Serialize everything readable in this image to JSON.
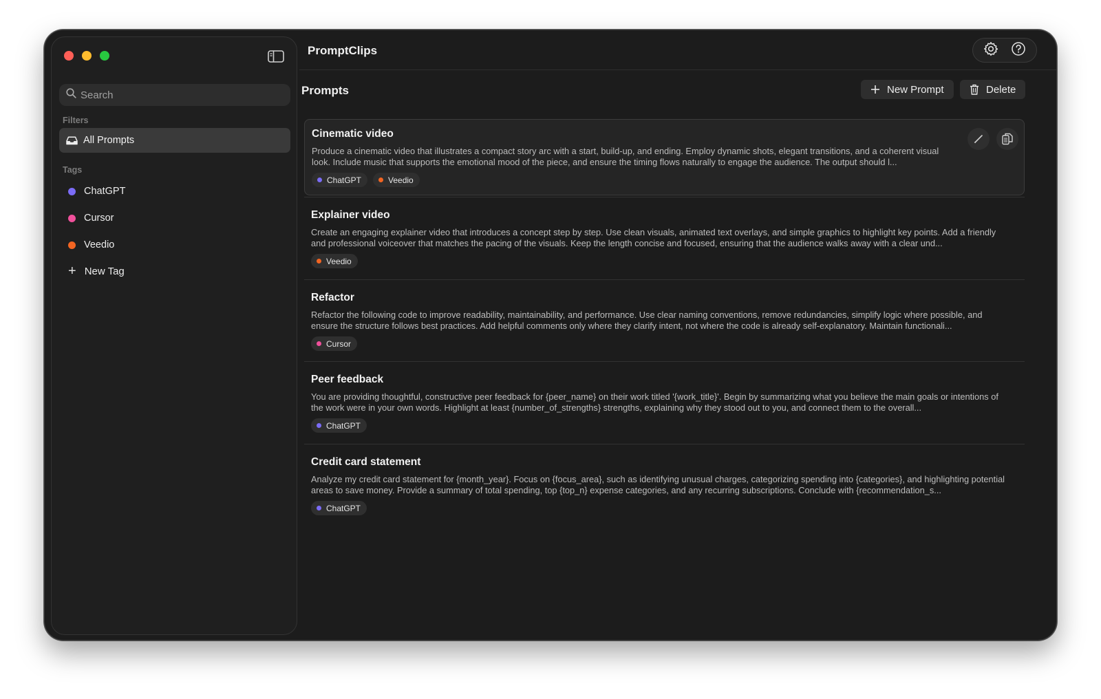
{
  "app": {
    "title": "PromptClips"
  },
  "colors": {
    "chatgpt": "#7b6cf6",
    "cursor": "#f0509b",
    "veedio": "#f26522"
  },
  "sidebar": {
    "search_placeholder": "Search",
    "filters_label": "Filters",
    "all_prompts_label": "All Prompts",
    "tags_label": "Tags",
    "tags": [
      {
        "label": "ChatGPT",
        "color": "#7b6cf6"
      },
      {
        "label": "Cursor",
        "color": "#f0509b"
      },
      {
        "label": "Veedio",
        "color": "#f26522"
      }
    ],
    "new_tag_label": "New Tag"
  },
  "main": {
    "heading": "Prompts",
    "new_prompt_label": "New Prompt",
    "delete_label": "Delete",
    "prompts": [
      {
        "title": "Cinematic video",
        "description": "Produce a cinematic video that illustrates a compact story arc with a start, build-up, and ending. Employ dynamic shots, elegant transitions, and a coherent visual look. Include music that supports the emotional mood of the piece, and ensure the timing flows naturally to engage the audience. The output should l...",
        "tags": [
          {
            "label": "ChatGPT",
            "color": "#7b6cf6"
          },
          {
            "label": "Veedio",
            "color": "#f26522"
          }
        ]
      },
      {
        "title": "Explainer video",
        "description": "Create an engaging explainer video that introduces a concept step by step. Use clean visuals, animated text overlays, and simple graphics to highlight key points. Add a friendly and professional voiceover that matches the pacing of the visuals. Keep the length concise and focused, ensuring that the audience walks away with a clear und...",
        "tags": [
          {
            "label": "Veedio",
            "color": "#f26522"
          }
        ]
      },
      {
        "title": "Refactor",
        "description": "Refactor the following code to improve readability, maintainability, and performance. Use clear naming conventions, remove redundancies, simplify logic where possible, and ensure the structure follows best practices. Add helpful comments only where they clarify intent, not where the code is already self-explanatory. Maintain functionali...",
        "tags": [
          {
            "label": "Cursor",
            "color": "#f0509b"
          }
        ]
      },
      {
        "title": "Peer feedback",
        "description": "You are providing thoughtful, constructive peer feedback for {peer_name} on their work titled '{work_title}'. Begin by summarizing what you believe the main goals or intentions of the work were in your own words. Highlight at least {number_of_strengths} strengths, explaining why they stood out to you, and connect them to the overall...",
        "tags": [
          {
            "label": "ChatGPT",
            "color": "#7b6cf6"
          }
        ]
      },
      {
        "title": "Credit card statement",
        "description": "Analyze my credit card statement for {month_year}. Focus on {focus_area}, such as identifying unusual charges, categorizing spending into {categories}, and highlighting potential areas to save money. Provide a summary of total spending, top {top_n} expense categories, and any recurring subscriptions. Conclude with {recommendation_s...",
        "tags": [
          {
            "label": "ChatGPT",
            "color": "#7b6cf6"
          }
        ]
      }
    ]
  }
}
